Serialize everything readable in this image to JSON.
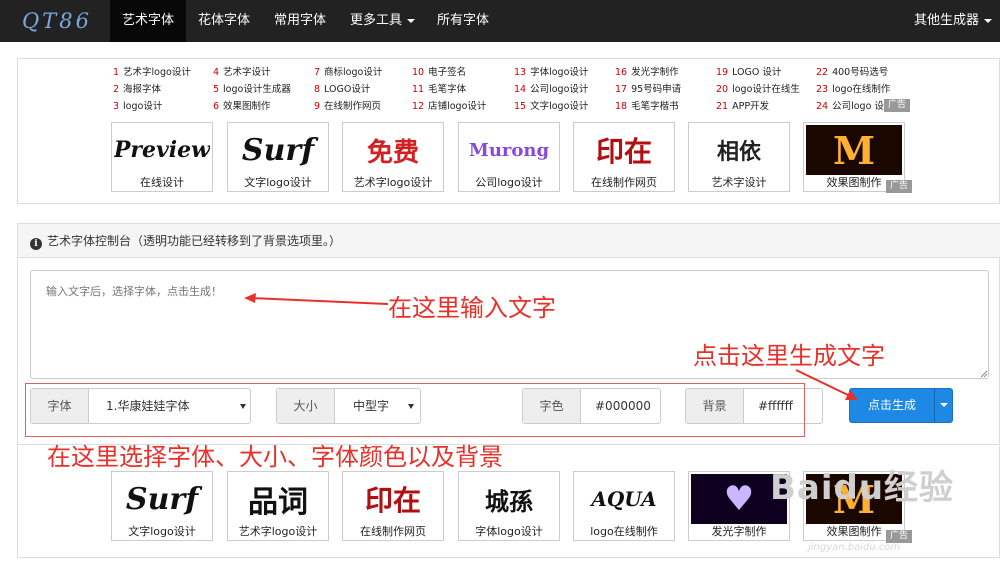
{
  "nav": {
    "logo": "QT86",
    "items": [
      "艺术字体",
      "花体字体",
      "常用字体",
      "更多工具",
      "所有字体"
    ],
    "right": "其他生成器"
  },
  "links": [
    [
      {
        "n": "1",
        "t": "艺术字logo设计"
      },
      {
        "n": "2",
        "t": "海报字体"
      },
      {
        "n": "3",
        "t": "logo设计"
      }
    ],
    [
      {
        "n": "4",
        "t": "艺术字设计"
      },
      {
        "n": "5",
        "t": "logo设计生成器"
      },
      {
        "n": "6",
        "t": "效果图制作"
      }
    ],
    [
      {
        "n": "7",
        "t": "商标logo设计"
      },
      {
        "n": "8",
        "t": "LOGO设计"
      },
      {
        "n": "9",
        "t": "在线制作网页"
      }
    ],
    [
      {
        "n": "10",
        "t": "电子签名"
      },
      {
        "n": "11",
        "t": "毛笔字体"
      },
      {
        "n": "12",
        "t": "店铺logo设计"
      }
    ],
    [
      {
        "n": "13",
        "t": "字体logo设计"
      },
      {
        "n": "14",
        "t": "公司logo设计"
      },
      {
        "n": "15",
        "t": "文字logo设计"
      }
    ],
    [
      {
        "n": "16",
        "t": "发光字制作"
      },
      {
        "n": "17",
        "t": "95号码申请"
      },
      {
        "n": "18",
        "t": "毛笔字楷书"
      }
    ],
    [
      {
        "n": "19",
        "t": "LOGO 设计"
      },
      {
        "n": "20",
        "t": "logo设计在线生"
      },
      {
        "n": "21",
        "t": "APP开发"
      }
    ],
    [
      {
        "n": "22",
        "t": "400号码选号"
      },
      {
        "n": "23",
        "t": "logo在线制作"
      },
      {
        "n": "24",
        "t": "公司logo 设"
      }
    ]
  ],
  "ad_label": "广告",
  "thumbs_top": [
    {
      "cap": "在线设计",
      "art": "Preview"
    },
    {
      "cap": "文字logo设计",
      "art": "Surf"
    },
    {
      "cap": "艺术字logo设计",
      "art": "免费"
    },
    {
      "cap": "公司logo设计",
      "art": "Murong"
    },
    {
      "cap": "在线制作网页",
      "art": "印在"
    },
    {
      "cap": "艺术字设计",
      "art": "相依"
    },
    {
      "cap": "效果图制作",
      "art": "M"
    }
  ],
  "control": {
    "title": "艺术字体控制台（透明功能已经转移到了背景选项里。）",
    "textarea_placeholder": "输入文字后，选择字体，点击生成！",
    "font_label": "字体",
    "font_value": "1.华康娃娃字体",
    "size_label": "大小",
    "size_value": "中型字",
    "color_label": "字色",
    "color_value": "#000000",
    "bg_label": "背景",
    "bg_value": "#ffffff",
    "generate_label": "点击生成"
  },
  "annotations": {
    "input": "在这里输入文字",
    "generate": "点击这里生成文字",
    "select": "在这里选择字体、大小、字体颜色以及背景"
  },
  "thumbs_bottom": [
    {
      "cap": "文字logo设计",
      "art": "Surf"
    },
    {
      "cap": "艺术字logo设计",
      "art": "品词"
    },
    {
      "cap": "在线制作网页",
      "art": "印在"
    },
    {
      "cap": "字体logo设计",
      "art": "城孫"
    },
    {
      "cap": "logo在线制作",
      "art": "AQUA"
    },
    {
      "cap": "发光字制作",
      "art": "♥"
    },
    {
      "cap": "效果图制作",
      "art": "M"
    }
  ],
  "watermark": {
    "main": "Baidu经验",
    "sub": "jingyan.baidu.com"
  },
  "colors": {
    "nav_bg": "#222222",
    "accent": "#1e88e5",
    "annotation": "#e8312a",
    "link_num": "#cc0000"
  }
}
